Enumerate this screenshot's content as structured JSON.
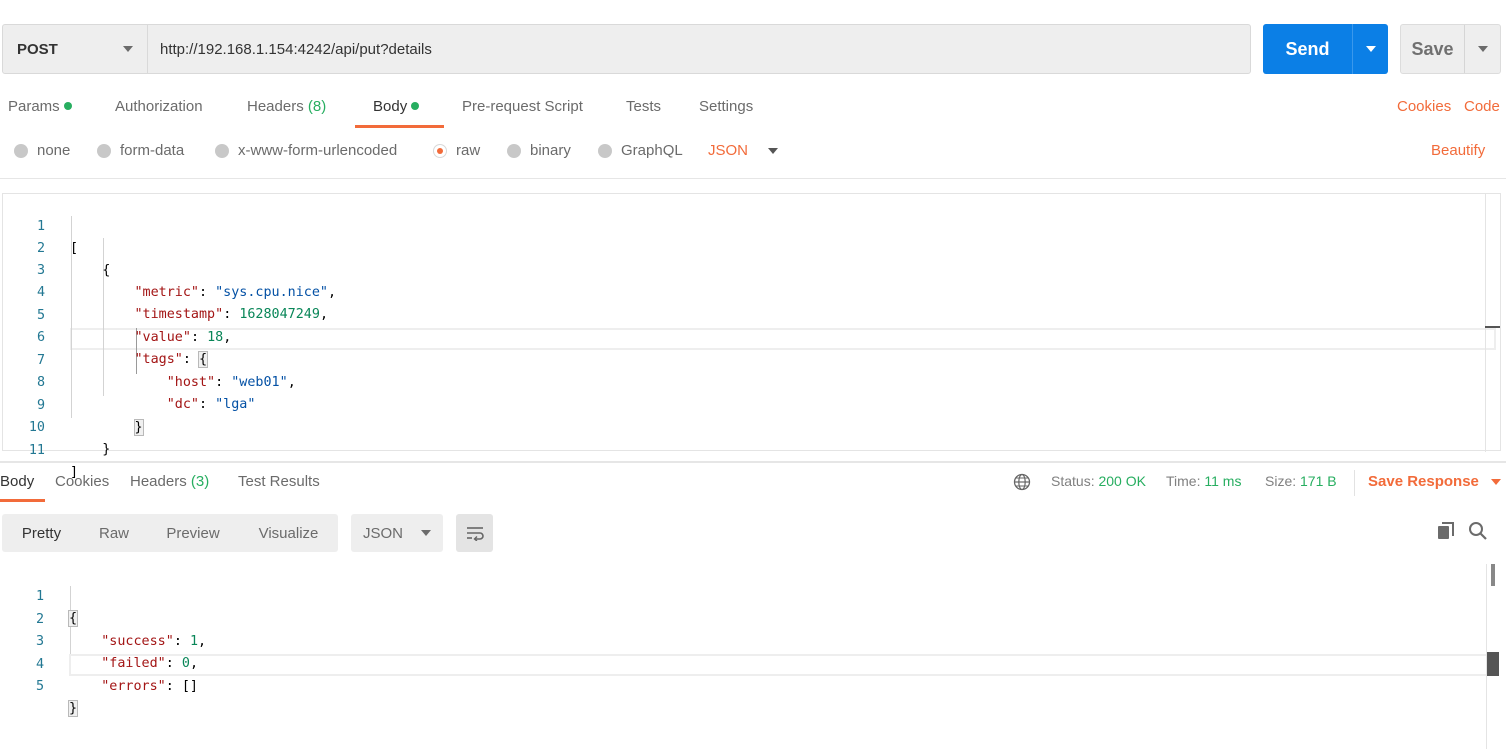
{
  "request": {
    "method": "POST",
    "url": "http://192.168.1.154:4242/api/put?details",
    "send_label": "Send",
    "save_label": "Save"
  },
  "request_tabs": {
    "params": "Params",
    "authorization": "Authorization",
    "headers": "Headers",
    "headers_count": "(8)",
    "body": "Body",
    "prerequest": "Pre-request Script",
    "tests": "Tests",
    "settings": "Settings",
    "cookies": "Cookies",
    "code": "Code"
  },
  "body_types": {
    "none": "none",
    "form_data": "form-data",
    "urlencoded": "x-www-form-urlencoded",
    "raw": "raw",
    "binary": "binary",
    "graphql": "GraphQL",
    "language": "JSON",
    "beautify": "Beautify",
    "selected": "raw"
  },
  "request_body": {
    "line_numbers": [
      "1",
      "2",
      "3",
      "4",
      "5",
      "6",
      "7",
      "8",
      "9",
      "10",
      "11"
    ],
    "open_bracket": "[",
    "open_brace": "{",
    "metric_key": "\"metric\"",
    "metric_value": "\"sys.cpu.nice\"",
    "timestamp_key": "\"timestamp\"",
    "timestamp_value": "1628047249",
    "value_key": "\"value\"",
    "value_value": "18",
    "tags_key": "\"tags\"",
    "tags_open": "{",
    "host_key": "\"host\"",
    "host_value": "\"web01\"",
    "dc_key": "\"dc\"",
    "dc_value": "\"lga\"",
    "tags_close": "}",
    "close_brace": "}",
    "close_bracket": "]"
  },
  "response_tabs": {
    "body": "Body",
    "cookies": "Cookies",
    "headers": "Headers",
    "headers_count": "(3)",
    "test_results": "Test Results"
  },
  "response_status": {
    "status_label": "Status:",
    "status_value": "200 OK",
    "time_label": "Time:",
    "time_value": "11 ms",
    "size_label": "Size:",
    "size_value": "171 B",
    "save_response": "Save Response"
  },
  "response_view": {
    "pretty": "Pretty",
    "raw": "Raw",
    "preview": "Preview",
    "visualize": "Visualize",
    "format": "JSON"
  },
  "response_body": {
    "line_numbers": [
      "1",
      "2",
      "3",
      "4",
      "5"
    ],
    "open_brace": "{",
    "success_key": "\"success\"",
    "success_value": "1",
    "failed_key": "\"failed\"",
    "failed_value": "0",
    "errors_key": "\"errors\"",
    "errors_value": "[]",
    "close_brace": "}"
  },
  "colors": {
    "accent": "#f26b3a",
    "send_button": "#0b7fe6",
    "success_green": "#27ae60"
  }
}
